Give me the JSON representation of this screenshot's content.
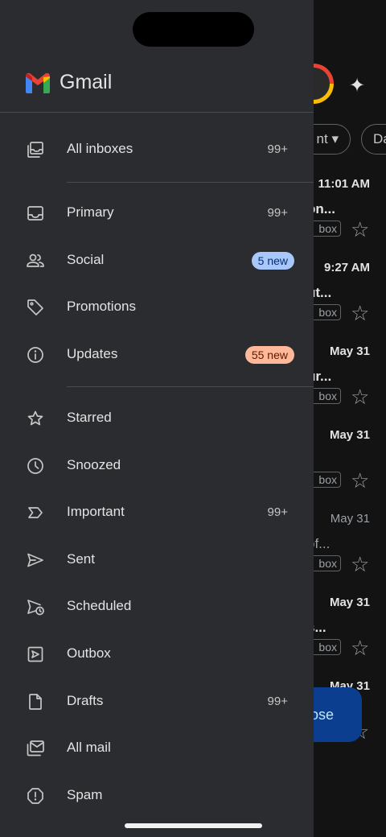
{
  "app": {
    "name": "Gmail"
  },
  "background": {
    "chips": [
      "nt",
      "Da"
    ],
    "emails": [
      {
        "time": "11:01 AM",
        "subject": "on...",
        "tag": "box",
        "time_style": "bold",
        "subject_style": "bold"
      },
      {
        "time": "9:27 AM",
        "subject": "ut...",
        "tag": "box",
        "time_style": "bold",
        "subject_style": "bold"
      },
      {
        "time": "May 31",
        "subject": "ur...",
        "tag": "box",
        "time_style": "bold",
        "subject_style": "bold"
      },
      {
        "time": "May 31",
        "subject": "",
        "tag": "box",
        "time_style": "bold",
        "subject_style": "bold"
      },
      {
        "time": "May 31",
        "subject": "of...",
        "tag": "box",
        "time_style": "light",
        "subject_style": "light"
      },
      {
        "time": "May 31",
        "subject": "s...",
        "tag": "box",
        "time_style": "bold",
        "subject_style": "bold"
      },
      {
        "time": "May 31",
        "subject": "",
        "tag": "",
        "time_style": "bold",
        "subject_style": "bold"
      }
    ],
    "compose_label": "ose"
  },
  "drawer": {
    "items": [
      {
        "id": "all-inboxes",
        "label": "All inboxes",
        "count": "99+",
        "icon": "all-inboxes-icon"
      },
      {
        "id": "primary",
        "label": "Primary",
        "count": "99+",
        "icon": "inbox-icon"
      },
      {
        "id": "social",
        "label": "Social",
        "badge": "5 new",
        "badge_color": "#a8c7fa",
        "icon": "people-icon"
      },
      {
        "id": "promotions",
        "label": "Promotions",
        "icon": "tag-icon"
      },
      {
        "id": "updates",
        "label": "Updates",
        "badge": "55 new",
        "badge_color": "#ffb899",
        "icon": "info-icon"
      },
      {
        "id": "starred",
        "label": "Starred",
        "icon": "star-icon"
      },
      {
        "id": "snoozed",
        "label": "Snoozed",
        "icon": "clock-icon"
      },
      {
        "id": "important",
        "label": "Important",
        "count": "99+",
        "icon": "important-icon"
      },
      {
        "id": "sent",
        "label": "Sent",
        "icon": "send-icon"
      },
      {
        "id": "scheduled",
        "label": "Scheduled",
        "icon": "scheduled-send-icon"
      },
      {
        "id": "outbox",
        "label": "Outbox",
        "icon": "outbox-icon"
      },
      {
        "id": "drafts",
        "label": "Drafts",
        "count": "99+",
        "icon": "draft-icon"
      },
      {
        "id": "all-mail",
        "label": "All mail",
        "icon": "all-mail-icon"
      },
      {
        "id": "spam",
        "label": "Spam",
        "icon": "spam-icon"
      }
    ]
  },
  "colors": {
    "drawer_bg": "#2b2c2f",
    "badge_blue": "#a8c7fa",
    "badge_orange": "#ffb899",
    "compose_bg": "#0b3e8e"
  }
}
